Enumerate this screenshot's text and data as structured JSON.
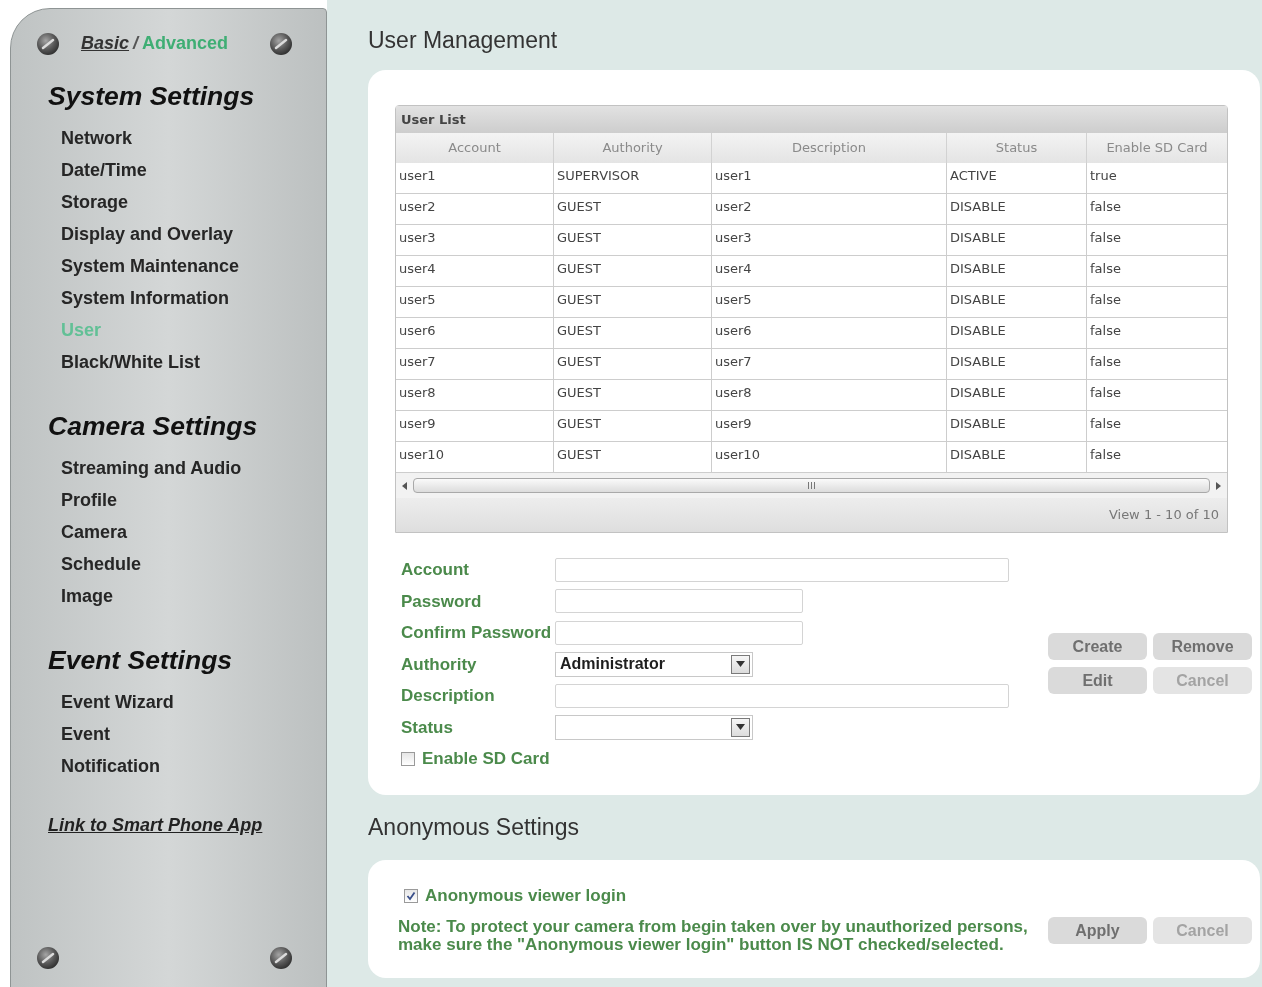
{
  "sidebar": {
    "view_modes": [
      {
        "label": "Basic",
        "selected": false
      },
      {
        "label": "Advanced",
        "selected": true
      }
    ],
    "separator": "/",
    "sections": [
      {
        "title": "System Settings",
        "items": [
          {
            "label": "Network",
            "selected": false
          },
          {
            "label": "Date/Time",
            "selected": false
          },
          {
            "label": "Storage",
            "selected": false
          },
          {
            "label": "Display and Overlay",
            "selected": false
          },
          {
            "label": "System Maintenance",
            "selected": false
          },
          {
            "label": "System Information",
            "selected": false
          },
          {
            "label": "User",
            "selected": true
          },
          {
            "label": "Black/White List",
            "selected": false
          }
        ]
      },
      {
        "title": "Camera Settings",
        "items": [
          {
            "label": "Streaming and Audio",
            "selected": false
          },
          {
            "label": "Profile",
            "selected": false
          },
          {
            "label": "Camera",
            "selected": false
          },
          {
            "label": "Schedule",
            "selected": false
          },
          {
            "label": "Image",
            "selected": false
          }
        ]
      },
      {
        "title": "Event Settings",
        "items": [
          {
            "label": "Event Wizard",
            "selected": false
          },
          {
            "label": "Event",
            "selected": false
          },
          {
            "label": "Notification",
            "selected": false
          }
        ]
      }
    ],
    "link": "Link to Smart Phone App"
  },
  "user_management": {
    "title": "User Management",
    "user_list": {
      "title": "User List",
      "columns": [
        "Account",
        "Authority",
        "Description",
        "Status",
        "Enable SD Card"
      ],
      "rows": [
        [
          "user1",
          "SUPERVISOR",
          "user1",
          "ACTIVE",
          "true"
        ],
        [
          "user2",
          "GUEST",
          "user2",
          "DISABLE",
          "false"
        ],
        [
          "user3",
          "GUEST",
          "user3",
          "DISABLE",
          "false"
        ],
        [
          "user4",
          "GUEST",
          "user4",
          "DISABLE",
          "false"
        ],
        [
          "user5",
          "GUEST",
          "user5",
          "DISABLE",
          "false"
        ],
        [
          "user6",
          "GUEST",
          "user6",
          "DISABLE",
          "false"
        ],
        [
          "user7",
          "GUEST",
          "user7",
          "DISABLE",
          "false"
        ],
        [
          "user8",
          "GUEST",
          "user8",
          "DISABLE",
          "false"
        ],
        [
          "user9",
          "GUEST",
          "user9",
          "DISABLE",
          "false"
        ],
        [
          "user10",
          "GUEST",
          "user10",
          "DISABLE",
          "false"
        ]
      ],
      "pager": "View 1 - 10 of 10"
    },
    "form": {
      "fields": [
        {
          "kind": "text",
          "label": "Account"
        },
        {
          "kind": "password",
          "label": "Password"
        },
        {
          "kind": "password",
          "label": "Confirm Password"
        },
        {
          "kind": "select",
          "label": "Authority",
          "value": "Administrator"
        },
        {
          "kind": "text",
          "label": "Description"
        },
        {
          "kind": "select",
          "label": "Status"
        },
        {
          "kind": "checkbox",
          "label": "Enable SD Card",
          "checked": false
        }
      ],
      "buttons": [
        {
          "label": "Create",
          "disabled": false
        },
        {
          "label": "Remove",
          "disabled": false
        },
        {
          "label": "Edit",
          "disabled": false
        },
        {
          "label": "Cancel",
          "disabled": true
        }
      ]
    }
  },
  "anonymous_settings": {
    "title": "Anonymous Settings",
    "option": {
      "label": "Anonymous viewer login",
      "checked": true
    },
    "note": "Note: To protect your camera from begin taken over by unauthorized persons, make sure the \"Anonymous viewer login\" button IS NOT checked/selected.",
    "buttons": [
      {
        "label": "Apply",
        "disabled": false
      },
      {
        "label": "Cancel",
        "disabled": true
      }
    ]
  }
}
